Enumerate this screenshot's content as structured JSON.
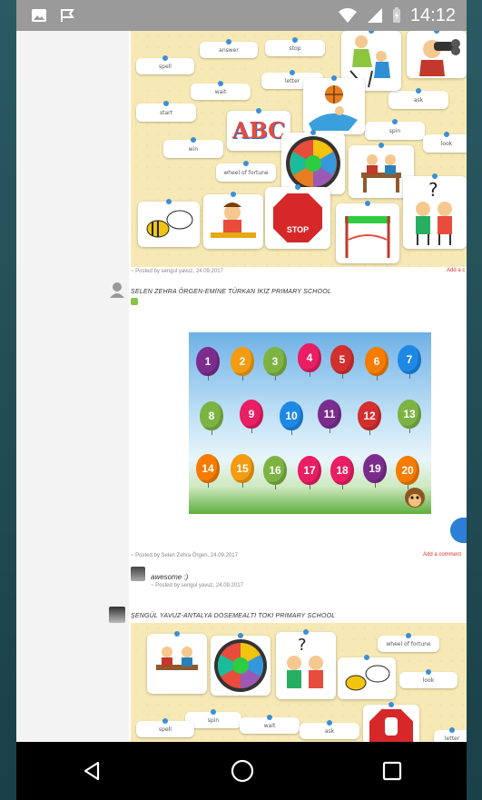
{
  "status_bar": {
    "time": "14:12"
  },
  "post1": {
    "cards": {
      "spell": "spell",
      "answer": "answer",
      "stop": "stop",
      "wait": "wait",
      "letter": "letter",
      "start": "start",
      "ask": "ask",
      "spin": "spin",
      "win": "win",
      "look": "look",
      "wheel": "wheel of fortune"
    },
    "abc": "ABC",
    "stop_sign": "STOP",
    "meta": "~ Posted by sengul yavuz, 24.09.2017",
    "add_comment": "Add a c"
  },
  "post2": {
    "title": "SELEN ZEHRA ÖRGEN-EMİNE TÜRKAN İKİZ PRIMARY SCHOOL",
    "balloons": [
      "1",
      "2",
      "3",
      "4",
      "5",
      "6",
      "7",
      "8",
      "9",
      "10",
      "11",
      "12",
      "13",
      "14",
      "15",
      "16",
      "17",
      "18",
      "19",
      "20"
    ],
    "meta": "~ Posted by Selen Zehra Örgen, 24.09.2017",
    "add_comment": "Add a comment",
    "comment": {
      "text": "awesome :)",
      "meta": "~ Posted by sengul yavuz, 24.09.2017"
    }
  },
  "post3": {
    "title": "ŞENGÜL YAVUZ-ANTALYA DOSEMEALTI TOKI PRIMARY SCHOOL",
    "cards": {
      "wheel": "wheel of fortune",
      "look": "look",
      "spin": "spin",
      "spell": "spell",
      "wait": "wait",
      "ask": "ask",
      "letter": "letter"
    }
  },
  "colors": {
    "board_bg": "#f7e9b5",
    "status_bar": "#9a9a9a",
    "accent_red": "#d6332b",
    "fab_blue": "#2d7ed6"
  }
}
